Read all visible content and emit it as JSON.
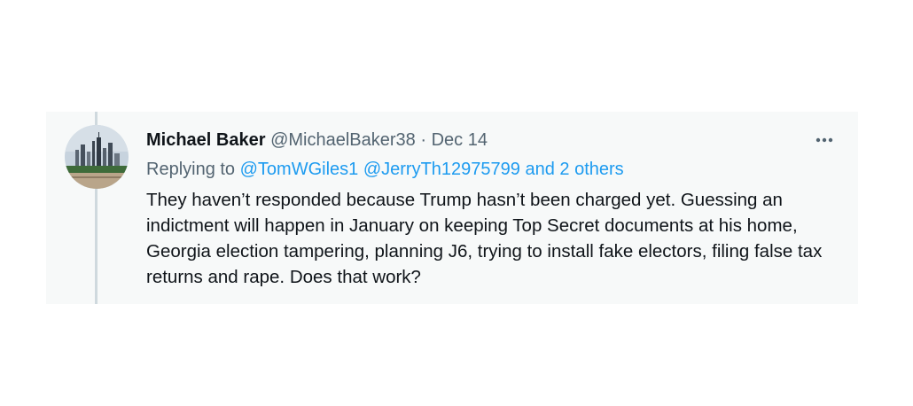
{
  "tweet": {
    "author_name": "Michael Baker",
    "author_handle": "@MichaelBaker38",
    "separator": "·",
    "date": "Dec 14",
    "replying_prefix": "Replying to",
    "reply_to": [
      "@TomWGiles1",
      "@JerryTh12975799"
    ],
    "reply_others": "and 2 others",
    "text": "They haven’t responded because Trump hasn’t been charged yet. Guessing an indictment will happen in January on keeping Top Secret documents at his home, Georgia election tampering, planning J6, trying to install fake electors, filing false tax returns and rape. Does that work?",
    "more_icon": "more-horizontal-icon",
    "avatar_description_icon": "city-skyline-avatar"
  },
  "colors": {
    "card_bg": "#f7f9f9",
    "link": "#1d9bf0",
    "text": "#0f1419",
    "muted": "#536471",
    "thread_line": "#cfd9de"
  }
}
